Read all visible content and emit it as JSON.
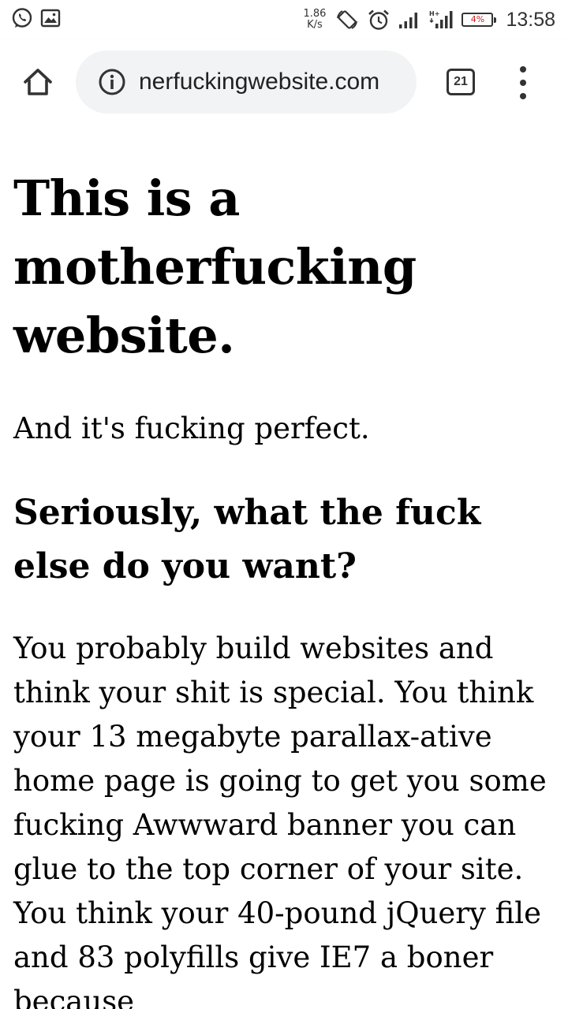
{
  "status_bar": {
    "left_icons": [
      "whatsapp-icon",
      "image-icon"
    ],
    "net_speed_value": "1.86",
    "net_speed_unit": "K/s",
    "right_icons": [
      "auto-rotate-icon",
      "alarm-icon",
      "signal-icon",
      "signal-data-icon"
    ],
    "battery": "4%",
    "battery_color": "#d12020",
    "time": "13:58"
  },
  "toolbar": {
    "home_icon": "home-icon",
    "info_icon": "info-icon",
    "url": "nerfuckingwebsite.com",
    "tab_count": "21",
    "menu_icon": "more-vert-icon"
  },
  "page": {
    "title": "This is a motherfucking website.",
    "subtitle": "And it's fucking perfect.",
    "heading": "Seriously, what the fuck else do you want?",
    "body": "You probably build websites and think your shit is special. You think your 13 megabyte parallax-ative home page is going to get you some fucking Awwward banner you can glue to the top corner of your site. You think your 40-pound jQuery file and 83 polyfills give IE7 a boner because"
  }
}
